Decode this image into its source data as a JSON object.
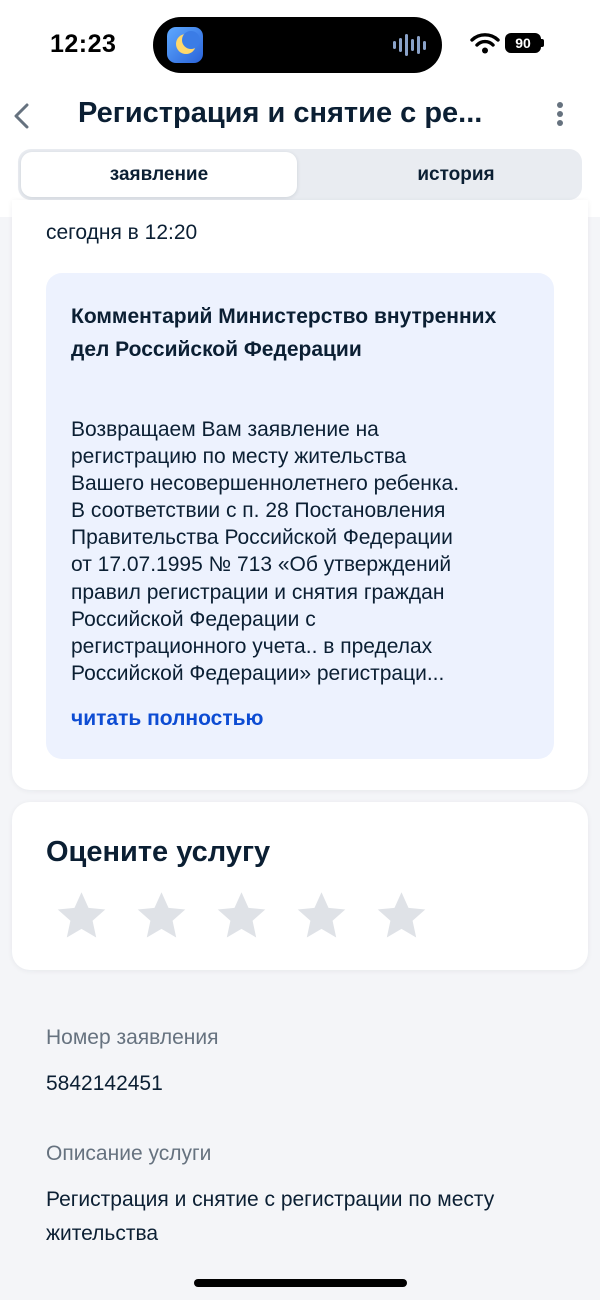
{
  "status_bar": {
    "time": "12:23",
    "battery": "90",
    "icons": [
      "app-icon",
      "voice-wave-icon",
      "wifi-icon",
      "battery-icon"
    ]
  },
  "header": {
    "title": "Регистрация и снятие с ре...",
    "back_icon": "chevron-left-icon",
    "menu_icon": "more-vertical-icon"
  },
  "tabs": [
    {
      "label": "заявление",
      "active": true
    },
    {
      "label": "история",
      "active": false
    }
  ],
  "status_card": {
    "time": "сегодня в 12:20",
    "comment": {
      "title": "Комментарий Министерство внутренних дел Российской Федерации",
      "body_lines": [
        "Возвращаем Вам заявление на",
        "регистрацию по месту жительства",
        "Вашего несовершеннолетнего ребенка.",
        "В соответствии с п. 28 Постановления",
        "Правительства Российской Федерации",
        "от 17.07.1995 № 713 «Об утверждений",
        "правил регистрации и снятия граждан",
        "Российской Федерации с",
        "регистрационного учета.. в пределах",
        "Российской Федерации» регистраци..."
      ],
      "read_more": "читать полностью"
    }
  },
  "rating": {
    "title": "Оцените услугу",
    "max_stars": 5,
    "selected": 0
  },
  "details": {
    "application_number_label": "Номер заявления",
    "application_number": "5842142451",
    "service_description_label": "Описание услуги",
    "service_description": "Регистрация и снятие с регистрации по месту жительства"
  },
  "colors": {
    "accent": "#0d4cd3",
    "text": "#0b1f33",
    "secondary_text": "#66727f",
    "background": "#f4f5f8",
    "comment_background": "#edf2fe",
    "star_empty": "#dfe2e7"
  }
}
